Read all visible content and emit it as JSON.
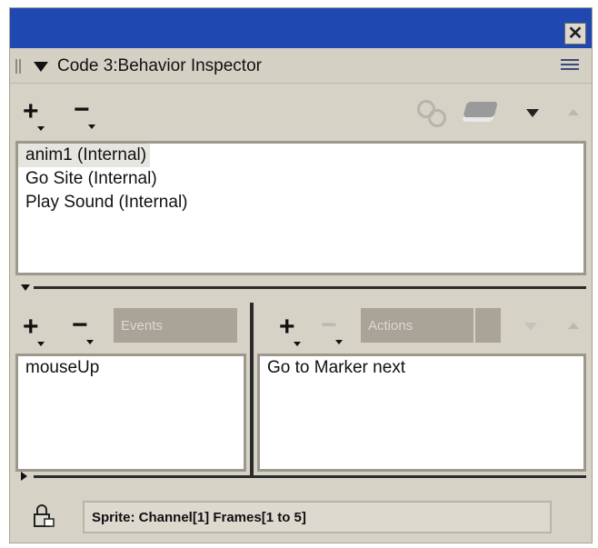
{
  "window": {
    "close_glyph": "✕",
    "title_bar_color": "#1f49b0"
  },
  "header": {
    "title": "Code 3:Behavior Inspector",
    "menu_icon": "options-menu-icon"
  },
  "toolbar": {
    "add_glyph": "+",
    "remove_glyph": "−",
    "icons": [
      "behavior-gears-icon",
      "library-book-icon",
      "shift-down-icon",
      "shift-up-icon"
    ]
  },
  "behaviors": {
    "items": [
      "anim1 (Internal)",
      "Go Site (Internal)",
      "Play Sound (Internal)"
    ],
    "selected_index": 0
  },
  "events_pane": {
    "add_glyph": "+",
    "remove_glyph": "−",
    "dropdown_label": "Events",
    "items": [
      "mouseUp"
    ]
  },
  "actions_pane": {
    "add_glyph": "+",
    "remove_glyph": "−",
    "dropdown_label": "Actions",
    "items": [
      "Go to Marker next"
    ]
  },
  "status": {
    "text": "Sprite:  Channel[1]  Frames[1 to 5]",
    "icon": "sprite-lock-icon"
  }
}
